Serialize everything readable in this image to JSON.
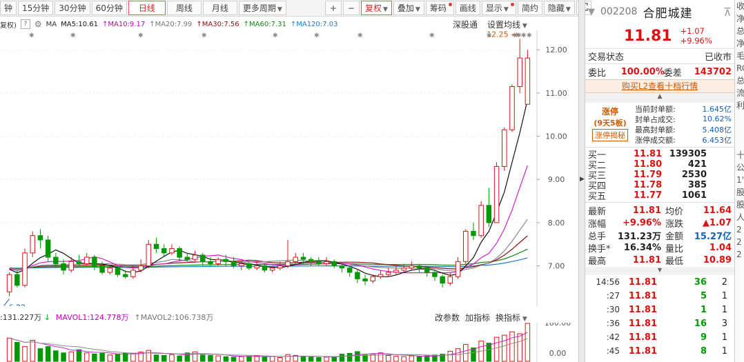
{
  "toolbar": {
    "periods": [
      "钟",
      "15分钟",
      "30分钟",
      "60分钟",
      "日线",
      "周线",
      "月线",
      "更多周期"
    ],
    "active_period": "日线",
    "tools": [
      "+",
      "−",
      "复权",
      "叠加",
      "筹码",
      "画线",
      "显示",
      "简约",
      "隐藏"
    ]
  },
  "ma_bar": {
    "fq": "复权)",
    "help": "?",
    "ma": "MA",
    "ma5": "MA5:10.61",
    "ma10": "MA10:9.17",
    "ma20": "MA20:7.99",
    "ma30": "MA30:7.56",
    "ma60": "MA60:7.31",
    "ma120": "MA120:7.03",
    "link1": "深股通",
    "link2": "设置均线"
  },
  "chart": {
    "y_ticks": [
      "12.00",
      "11.00",
      "10.00",
      "9.00",
      "8.00",
      "7.00"
    ],
    "high_label": "12.25",
    "low_label": "6.22",
    "ma_colors": {
      "ma5": "#111111",
      "ma10": "#cc22cc",
      "ma20": "#8a8a8a",
      "ma30": "#8b1010",
      "ma60": "#118811",
      "ma120": "#2277cc"
    }
  },
  "chart_data": {
    "type": "line",
    "title": "",
    "ylim": [
      6.1,
      12.45
    ],
    "candles": [
      [
        6.4,
        6.8,
        6.85,
        6.3
      ],
      [
        6.8,
        6.55,
        6.9,
        6.5
      ],
      [
        6.55,
        7.3,
        7.4,
        6.5
      ],
      [
        7.3,
        7.7,
        7.8,
        7.2
      ],
      [
        7.7,
        7.6,
        7.85,
        7.4
      ],
      [
        7.6,
        7.2,
        7.7,
        7.1
      ],
      [
        7.2,
        7.05,
        7.3,
        6.95
      ],
      [
        7.05,
        6.9,
        7.15,
        6.8
      ],
      [
        6.9,
        7.1,
        7.2,
        6.85
      ],
      [
        7.1,
        7.05,
        7.25,
        7.0
      ],
      [
        7.05,
        7.2,
        7.3,
        7.0
      ],
      [
        7.2,
        7.0,
        7.25,
        6.9
      ],
      [
        7.0,
        6.85,
        7.1,
        6.8
      ],
      [
        6.85,
        6.95,
        7.0,
        6.8
      ],
      [
        6.95,
        6.8,
        7.0,
        6.75
      ],
      [
        6.8,
        6.75,
        6.9,
        6.7
      ],
      [
        6.75,
        6.9,
        7.0,
        6.7
      ],
      [
        6.9,
        7.0,
        7.15,
        6.85
      ],
      [
        7.0,
        7.5,
        7.6,
        6.95
      ],
      [
        7.5,
        7.4,
        7.65,
        7.3
      ],
      [
        7.4,
        7.3,
        7.5,
        7.2
      ],
      [
        7.3,
        7.4,
        7.5,
        7.25
      ],
      [
        7.4,
        7.2,
        7.45,
        7.1
      ],
      [
        7.2,
        7.15,
        7.3,
        7.1
      ],
      [
        7.15,
        7.25,
        7.35,
        7.1
      ],
      [
        7.25,
        7.1,
        7.3,
        7.0
      ],
      [
        7.1,
        7.05,
        7.2,
        7.0
      ],
      [
        7.05,
        7.15,
        7.2,
        7.0
      ],
      [
        7.15,
        7.1,
        7.25,
        7.0
      ],
      [
        7.1,
        7.0,
        7.2,
        6.95
      ],
      [
        7.0,
        7.05,
        7.1,
        6.9
      ],
      [
        7.05,
        6.95,
        7.1,
        6.9
      ],
      [
        6.95,
        7.0,
        7.1,
        6.9
      ],
      [
        7.0,
        6.9,
        7.05,
        6.85
      ],
      [
        6.9,
        6.95,
        7.0,
        6.85
      ],
      [
        6.95,
        7.0,
        7.1,
        6.9
      ],
      [
        7.0,
        7.1,
        7.6,
        6.95
      ],
      [
        7.1,
        7.2,
        7.3,
        7.05
      ],
      [
        7.2,
        7.15,
        7.3,
        7.05
      ],
      [
        7.15,
        7.1,
        7.2,
        7.0
      ],
      [
        7.1,
        7.05,
        7.2,
        7.0
      ],
      [
        7.05,
        7.1,
        7.2,
        7.0
      ],
      [
        7.1,
        7.0,
        7.15,
        6.95
      ],
      [
        7.0,
        6.95,
        7.05,
        6.85
      ],
      [
        6.95,
        6.85,
        7.0,
        6.75
      ],
      [
        6.85,
        6.7,
        6.9,
        6.6
      ],
      [
        6.7,
        6.65,
        6.8,
        6.55
      ],
      [
        6.65,
        6.75,
        6.8,
        6.6
      ],
      [
        6.75,
        6.8,
        6.9,
        6.7
      ],
      [
        6.8,
        6.85,
        6.95,
        6.75
      ],
      [
        6.85,
        6.9,
        7.0,
        6.8
      ],
      [
        6.9,
        6.95,
        7.05,
        6.85
      ],
      [
        6.95,
        7.0,
        7.1,
        6.9
      ],
      [
        7.0,
        6.95,
        7.05,
        6.85
      ],
      [
        6.95,
        6.85,
        7.0,
        6.75
      ],
      [
        6.85,
        6.75,
        6.9,
        6.65
      ],
      [
        6.75,
        6.6,
        6.8,
        6.5
      ],
      [
        6.6,
        6.75,
        6.85,
        6.55
      ],
      [
        6.75,
        7.1,
        7.2,
        6.7
      ],
      [
        7.1,
        7.8,
        7.85,
        7.05
      ],
      [
        7.8,
        7.7,
        8.0,
        7.6
      ],
      [
        7.7,
        8.4,
        8.5,
        7.65
      ],
      [
        8.4,
        8.0,
        8.8,
        7.9
      ],
      [
        8.0,
        9.3,
        9.4,
        8.0
      ],
      [
        9.3,
        10.15,
        10.2,
        9.2
      ],
      [
        10.15,
        11.15,
        11.2,
        10.1
      ],
      [
        11.15,
        11.81,
        12.25,
        11.0
      ],
      [
        10.74,
        11.81,
        12.0,
        10.89
      ]
    ],
    "volumes": [
      110,
      90,
      70,
      100,
      60,
      70,
      50,
      40,
      45,
      55,
      40,
      35,
      38,
      30,
      34,
      38,
      36,
      44,
      52,
      30,
      28,
      32,
      26,
      40,
      45,
      30,
      28,
      26,
      22,
      20,
      22,
      24,
      26,
      20,
      24,
      18,
      32,
      28,
      22,
      20,
      18,
      20,
      22,
      34,
      38,
      46,
      30,
      34,
      40,
      28,
      24,
      22,
      26,
      22,
      26,
      30,
      34,
      48,
      60,
      80,
      64,
      96,
      86,
      114,
      124,
      140,
      131,
      180
    ]
  },
  "volume_bar": {
    "vol": ":131.227万",
    "mavol1": "MAVOL1:124.778万",
    "mavol2": "MAVOL2:106.738万",
    "links": [
      "改参数",
      "加指标",
      "换指标"
    ],
    "y_ticks": [
      "180.00",
      "0.00"
    ]
  },
  "panel": {
    "code": "002208",
    "name": "合肥城建",
    "price": "11.81",
    "change": "+1.07",
    "change_pct": "+9.96%",
    "trade_status_label": "交易状态",
    "trade_status": "已收市",
    "weibi_label": "委比",
    "weibi": "100.00%",
    "weicha_label": "委差",
    "weicha": "143702",
    "l2_link": "购买L2查看十档行情",
    "limit": {
      "badge": "涨停",
      "days": "(9天5板)",
      "secret": "涨停揭秘",
      "rows": [
        {
          "label": "当前封单额:",
          "value": "1.645亿"
        },
        {
          "label": "封单占成交:",
          "value": "10.62%"
        },
        {
          "label": "最高封单额:",
          "value": "5.408亿"
        },
        {
          "label": "涨停成交额:",
          "value": "6.453亿"
        }
      ]
    },
    "bids": [
      {
        "label": "买一",
        "price": "11.81",
        "vol": "139305"
      },
      {
        "label": "买二",
        "price": "11.80",
        "vol": "421"
      },
      {
        "label": "买三",
        "price": "11.79",
        "vol": "2530"
      },
      {
        "label": "买四",
        "price": "11.78",
        "vol": "385"
      },
      {
        "label": "买五",
        "price": "11.77",
        "vol": "1061"
      }
    ],
    "stats": [
      {
        "l1": "最新",
        "v1": "11.81",
        "l2": "均价",
        "v2": "11.64",
        "c1": "red",
        "c2": "red"
      },
      {
        "l1": "涨幅",
        "v1": "+9.96%",
        "l2": "涨跌",
        "v2": "▲1.07",
        "c1": "red",
        "c2": "red"
      },
      {
        "l1": "总手",
        "v1": "131.23万",
        "l2": "金额",
        "v2": "15.27亿",
        "c1": "dark",
        "c2": "blue"
      },
      {
        "l1": "换手*",
        "v1": "16.34%",
        "l2": "量比",
        "v2": "1.04",
        "c1": "dark",
        "c2": "red"
      },
      {
        "l1": "最高",
        "v1": "11.81",
        "l2": "最低",
        "v2": "10.89",
        "c1": "red",
        "c2": "red"
      }
    ],
    "ticks": [
      {
        "time": "14:56",
        "price": "11.81",
        "vol": "36",
        "n": "2"
      },
      {
        "time": ":27",
        "price": "11.81",
        "vol": "5",
        "n": "1"
      },
      {
        "time": ":30",
        "price": "11.81",
        "vol": "1",
        "n": "1"
      },
      {
        "time": ":36",
        "price": "11.81",
        "vol": "16",
        "n": "3"
      },
      {
        "time": ":42",
        "price": "11.81",
        "vol": "9",
        "n": "1"
      },
      {
        "time": ":45",
        "price": "11.81",
        "vol": "8",
        "n": "1"
      }
    ]
  },
  "rightcut": [
    "收",
    "净",
    "总",
    "净",
    "毛",
    "RC",
    "总",
    "流",
    "利",
    "",
    "",
    "",
    "十",
    "公",
    "1'",
    "股",
    "股",
    "人",
    "2",
    "2",
    "2"
  ]
}
